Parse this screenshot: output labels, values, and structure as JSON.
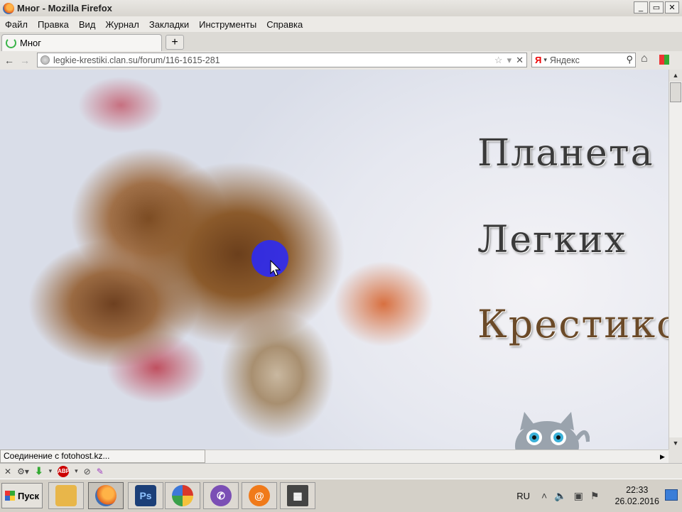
{
  "window": {
    "title": "Мног - Mozilla Firefox",
    "buttons": [
      "_",
      "▭",
      "✕"
    ]
  },
  "menu": {
    "items": [
      "Файл",
      "Правка",
      "Вид",
      "Журнал",
      "Закладки",
      "Инструменты",
      "Справка"
    ]
  },
  "tab": {
    "label": "Мног",
    "new_tab": "+"
  },
  "nav": {
    "back": "←",
    "forward": "→",
    "url_host": "legkie-krestiki.clan.su",
    "url_path": "/forum/116-1615-281",
    "search_engine": "Я",
    "search_placeholder": "Яндекс"
  },
  "page": {
    "line1": "Планета",
    "line2": "Легких",
    "line3": "Крестиков"
  },
  "status": {
    "text": "Соединение с fotohost.kz..."
  },
  "taskbar": {
    "start_label": "Пуск",
    "apps": [
      {
        "name": "explorer",
        "label": "",
        "color": "#e8b64a"
      },
      {
        "name": "firefox",
        "label": "",
        "color": "#e2631f"
      },
      {
        "name": "photoshop",
        "label": "Ps",
        "color": "#1c3f78"
      },
      {
        "name": "picasa",
        "label": "",
        "color": "#d8382a"
      },
      {
        "name": "viber",
        "label": "",
        "color": "#7b4fb5"
      },
      {
        "name": "mail",
        "label": "@",
        "color": "#f07a1a"
      },
      {
        "name": "video",
        "label": "",
        "color": "#444444"
      }
    ],
    "lang": "RU",
    "time": "22:33",
    "date": "26.02.2016"
  }
}
